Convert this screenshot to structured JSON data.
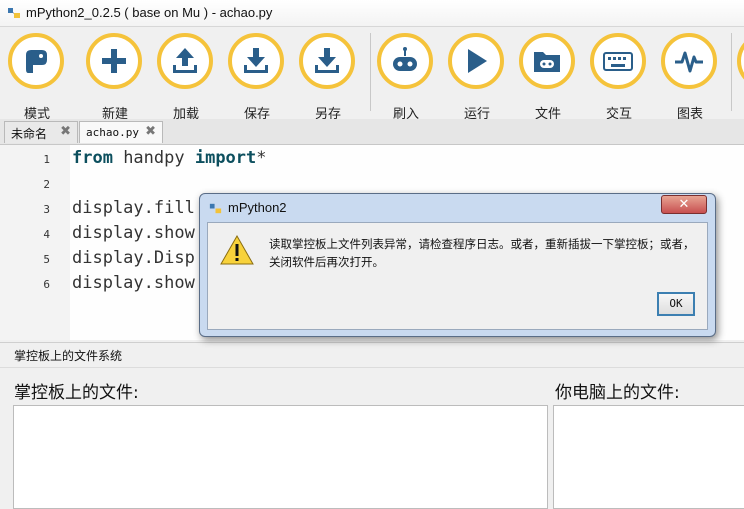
{
  "window": {
    "title": "mPython2_0.2.5 ( base on Mu ) - achao.py"
  },
  "toolbar": {
    "buttons": [
      {
        "label": "模式",
        "icon": "python-logo-icon"
      },
      {
        "label": "新建",
        "icon": "plus-icon"
      },
      {
        "label": "加载",
        "icon": "upload-icon"
      },
      {
        "label": "保存",
        "icon": "download-icon"
      },
      {
        "label": "另存",
        "icon": "download-icon"
      },
      {
        "label": "刷入",
        "icon": "board-icon"
      },
      {
        "label": "运行",
        "icon": "play-icon"
      },
      {
        "label": "文件",
        "icon": "folder-icon"
      },
      {
        "label": "交互",
        "icon": "keyboard-icon"
      },
      {
        "label": "图表",
        "icon": "pulse-icon"
      }
    ],
    "accent_color": "#f5c33b",
    "icon_color": "#2a5e8a"
  },
  "tabs": [
    {
      "label": "未命名",
      "close": "✖"
    },
    {
      "label": "achao.py",
      "close": "✖"
    }
  ],
  "editor": {
    "line_numbers": [
      "1",
      "2",
      "3",
      "4",
      "5",
      "6"
    ],
    "lines": [
      {
        "kw1": "from",
        "mid": " handpy ",
        "kw2": "import",
        "rest": "*"
      },
      {
        "text": ""
      },
      {
        "text": "display.fill"
      },
      {
        "text": "display.show"
      },
      {
        "text": "display.Disp"
      },
      {
        "text": "display.show"
      }
    ]
  },
  "file_panel": {
    "header": "掌控板上的文件系统",
    "board_label": "掌控板上的文件:",
    "computer_label": "你电脑上的文件:"
  },
  "dialog": {
    "title": "mPython2",
    "close_symbol": "✕",
    "message": "读取掌控板上文件列表异常，请检查程序日志。或者，重新插拔一下掌控板；或者，关闭软件后再次打开。",
    "ok_label": "OK"
  }
}
